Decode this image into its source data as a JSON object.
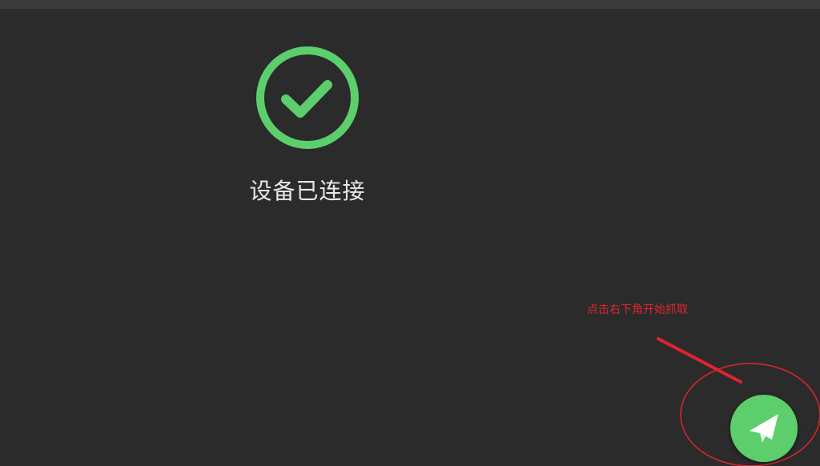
{
  "status": {
    "text": "设备已连接",
    "icon": "check-circle-icon",
    "color": "#5ccf6c"
  },
  "annotation": {
    "hint": "点击右下角开始抓取",
    "color": "#e0242f"
  },
  "fab": {
    "icon": "paper-plane-icon",
    "color": "#5ccf6c"
  }
}
